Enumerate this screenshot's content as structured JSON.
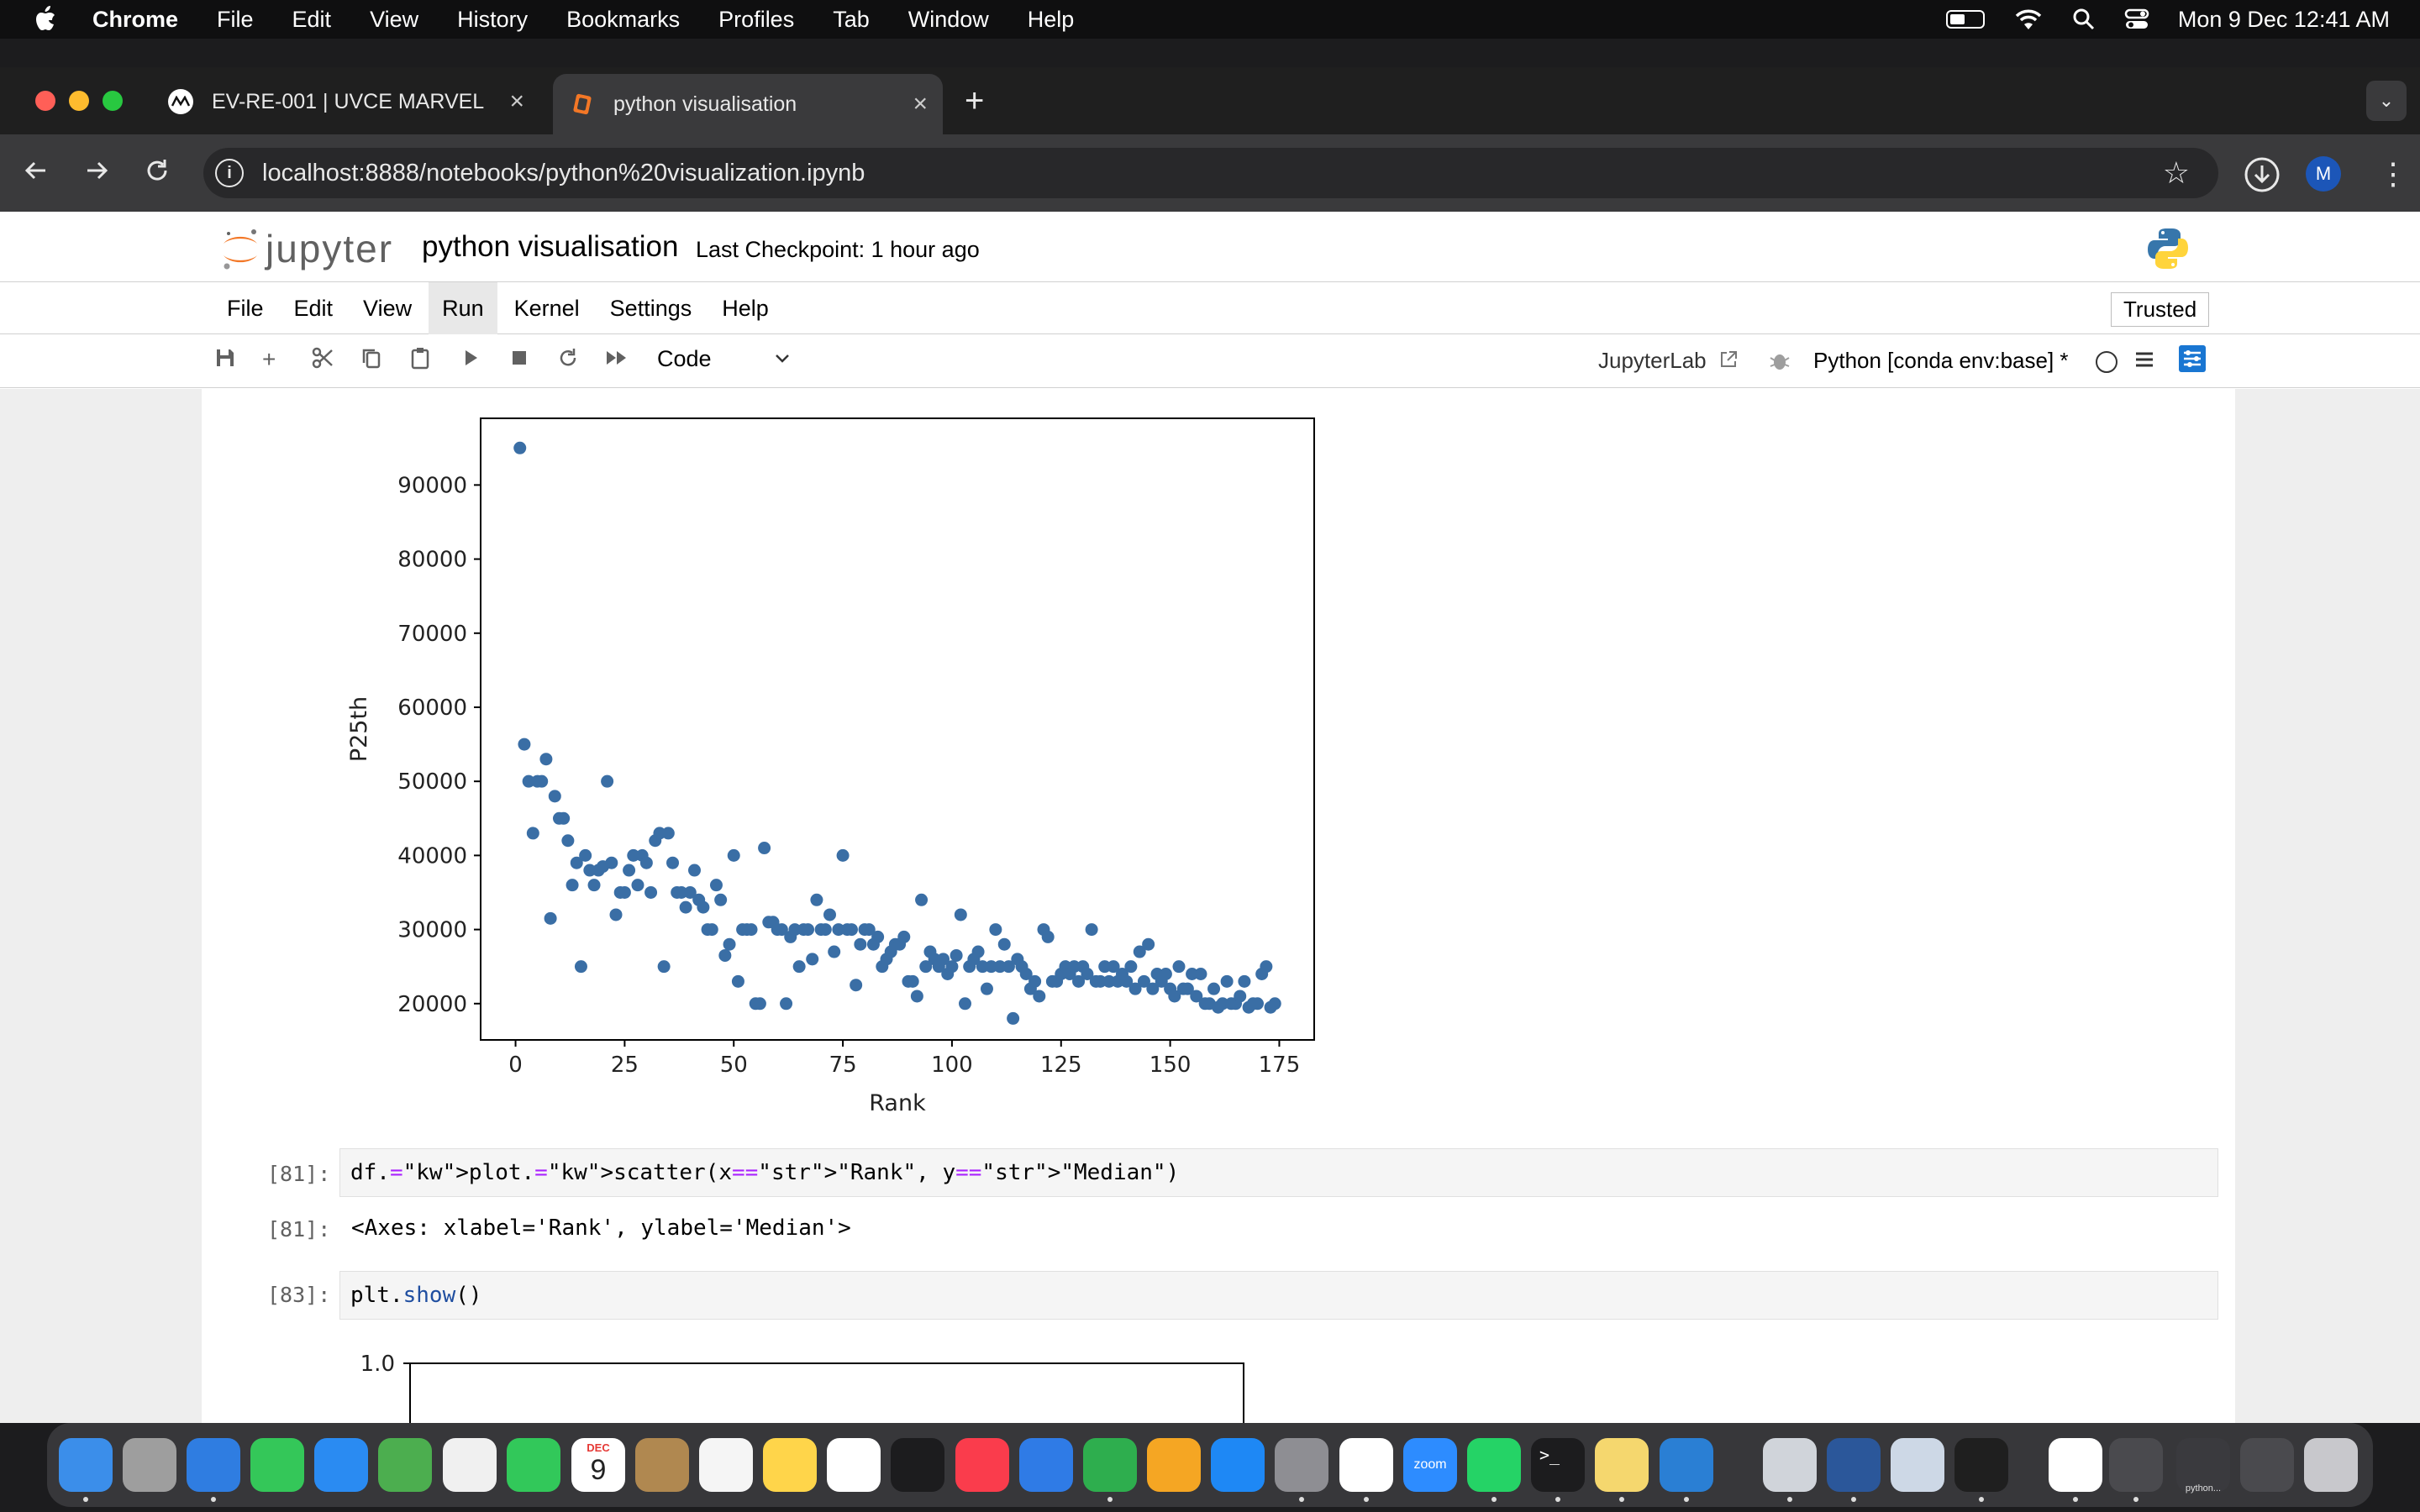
{
  "menubar": {
    "app_name": "Chrome",
    "items": [
      "File",
      "Edit",
      "View",
      "History",
      "Bookmarks",
      "Profiles",
      "Tab",
      "Window",
      "Help"
    ],
    "clock": "Mon 9 Dec  12:41 AM",
    "battery_level": 0.45
  },
  "browser": {
    "tabs": [
      {
        "title": "EV-RE-001 | UVCE MARVEL",
        "favicon": "marvel-logo-icon",
        "active": false
      },
      {
        "title": "python visualisation",
        "favicon": "jupyter-icon",
        "active": true
      }
    ],
    "url": "localhost:8888/notebooks/python%20visualization.ipynb",
    "profile_initial": "M"
  },
  "jupyter": {
    "logo_text": "jupyter",
    "notebook_title": "python visualisation",
    "checkpoint": "Last Checkpoint: 1 hour ago",
    "menu": [
      "File",
      "Edit",
      "View",
      "Run",
      "Kernel",
      "Settings",
      "Help"
    ],
    "active_menu": "Run",
    "trusted": "Trusted",
    "cell_type": "Code",
    "jupyterlab_link": "JupyterLab",
    "kernel": "Python [conda env:base] *"
  },
  "cells": {
    "c81_prompt_in": "[81]:",
    "c81_code": "df.plot.scatter(x=\"Rank\", y=\"Median\")",
    "c81_prompt_out": "[81]:",
    "c81_output": "<Axes: xlabel='Rank', ylabel='Median'>",
    "c83_prompt_in": "[83]:",
    "c83_code": "plt.show()"
  },
  "chart_data": [
    {
      "type": "scatter",
      "xlabel": "Rank",
      "ylabel": "P25th",
      "xlim": [
        -8,
        183
      ],
      "ylim": [
        15100,
        99000
      ],
      "xticks": [
        0,
        25,
        50,
        75,
        100,
        125,
        150,
        175
      ],
      "yticks": [
        20000,
        30000,
        40000,
        50000,
        60000,
        70000,
        80000,
        90000
      ],
      "grid": false,
      "marker_color": "#3a6ea5",
      "points": [
        [
          1,
          95000
        ],
        [
          2,
          55000
        ],
        [
          3,
          50000
        ],
        [
          4,
          43000
        ],
        [
          5,
          50000
        ],
        [
          6,
          50000
        ],
        [
          7,
          53000
        ],
        [
          8,
          31500
        ],
        [
          9,
          48000
        ],
        [
          10,
          45000
        ],
        [
          11,
          45000
        ],
        [
          12,
          42000
        ],
        [
          13,
          36000
        ],
        [
          14,
          39000
        ],
        [
          15,
          25000
        ],
        [
          16,
          40000
        ],
        [
          17,
          38000
        ],
        [
          18,
          36000
        ],
        [
          19,
          38000
        ],
        [
          20,
          38500
        ],
        [
          21,
          50000
        ],
        [
          22,
          39000
        ],
        [
          23,
          32000
        ],
        [
          24,
          35000
        ],
        [
          25,
          35000
        ],
        [
          26,
          38000
        ],
        [
          27,
          40000
        ],
        [
          28,
          36000
        ],
        [
          29,
          40000
        ],
        [
          30,
          39000
        ],
        [
          31,
          35000
        ],
        [
          32,
          42000
        ],
        [
          33,
          43000
        ],
        [
          34,
          25000
        ],
        [
          35,
          43000
        ],
        [
          36,
          39000
        ],
        [
          37,
          35000
        ],
        [
          38,
          35000
        ],
        [
          39,
          33000
        ],
        [
          40,
          35000
        ],
        [
          41,
          38000
        ],
        [
          42,
          34000
        ],
        [
          43,
          33000
        ],
        [
          44,
          30000
        ],
        [
          45,
          30000
        ],
        [
          46,
          36000
        ],
        [
          47,
          34000
        ],
        [
          48,
          26500
        ],
        [
          49,
          28000
        ],
        [
          50,
          40000
        ],
        [
          51,
          23000
        ],
        [
          52,
          30000
        ],
        [
          53,
          30000
        ],
        [
          54,
          30000
        ],
        [
          55,
          20000
        ],
        [
          56,
          20000
        ],
        [
          57,
          41000
        ],
        [
          58,
          31000
        ],
        [
          59,
          31000
        ],
        [
          60,
          30000
        ],
        [
          61,
          30000
        ],
        [
          62,
          20000
        ],
        [
          63,
          29000
        ],
        [
          64,
          30000
        ],
        [
          65,
          25000
        ],
        [
          66,
          30000
        ],
        [
          67,
          30000
        ],
        [
          68,
          26000
        ],
        [
          69,
          34000
        ],
        [
          70,
          30000
        ],
        [
          71,
          30000
        ],
        [
          72,
          32000
        ],
        [
          73,
          27000
        ],
        [
          74,
          30000
        ],
        [
          75,
          40000
        ],
        [
          76,
          30000
        ],
        [
          77,
          30000
        ],
        [
          78,
          22500
        ],
        [
          79,
          28000
        ],
        [
          80,
          30000
        ],
        [
          81,
          30000
        ],
        [
          82,
          28000
        ],
        [
          83,
          29000
        ],
        [
          84,
          25000
        ],
        [
          85,
          26000
        ],
        [
          86,
          27000
        ],
        [
          87,
          28000
        ],
        [
          88,
          28000
        ],
        [
          89,
          29000
        ],
        [
          90,
          23000
        ],
        [
          91,
          23000
        ],
        [
          92,
          21000
        ],
        [
          93,
          34000
        ],
        [
          94,
          25000
        ],
        [
          95,
          27000
        ],
        [
          96,
          26000
        ],
        [
          97,
          25000
        ],
        [
          98,
          26000
        ],
        [
          99,
          24000
        ],
        [
          100,
          25000
        ],
        [
          101,
          26500
        ],
        [
          102,
          32000
        ],
        [
          103,
          20000
        ],
        [
          104,
          25000
        ],
        [
          105,
          26000
        ],
        [
          106,
          27000
        ],
        [
          107,
          25000
        ],
        [
          108,
          22000
        ],
        [
          109,
          25000
        ],
        [
          110,
          30000
        ],
        [
          111,
          25000
        ],
        [
          112,
          28000
        ],
        [
          113,
          25000
        ],
        [
          114,
          18000
        ],
        [
          115,
          26000
        ],
        [
          116,
          25000
        ],
        [
          117,
          24000
        ],
        [
          118,
          22000
        ],
        [
          119,
          23000
        ],
        [
          120,
          21000
        ],
        [
          121,
          30000
        ],
        [
          122,
          29000
        ],
        [
          123,
          23000
        ],
        [
          124,
          23000
        ],
        [
          125,
          24000
        ],
        [
          126,
          25000
        ],
        [
          127,
          24000
        ],
        [
          128,
          25000
        ],
        [
          129,
          23000
        ],
        [
          130,
          25000
        ],
        [
          131,
          24000
        ],
        [
          132,
          30000
        ],
        [
          133,
          23000
        ],
        [
          134,
          23000
        ],
        [
          135,
          25000
        ],
        [
          136,
          23000
        ],
        [
          137,
          25000
        ],
        [
          138,
          23000
        ],
        [
          139,
          24000
        ],
        [
          140,
          23000
        ],
        [
          141,
          25000
        ],
        [
          142,
          22000
        ],
        [
          143,
          27000
        ],
        [
          144,
          23000
        ],
        [
          145,
          28000
        ],
        [
          146,
          22000
        ],
        [
          147,
          24000
        ],
        [
          148,
          23000
        ],
        [
          149,
          24000
        ],
        [
          150,
          22000
        ],
        [
          151,
          21000
        ],
        [
          152,
          25000
        ],
        [
          153,
          22000
        ],
        [
          154,
          22000
        ],
        [
          155,
          24000
        ],
        [
          156,
          21000
        ],
        [
          157,
          24000
        ],
        [
          158,
          20000
        ],
        [
          159,
          20000
        ],
        [
          160,
          22000
        ],
        [
          161,
          19500
        ],
        [
          162,
          20000
        ],
        [
          163,
          23000
        ],
        [
          164,
          20000
        ],
        [
          165,
          20000
        ],
        [
          166,
          21000
        ],
        [
          167,
          23000
        ],
        [
          168,
          19500
        ],
        [
          169,
          20000
        ],
        [
          170,
          20000
        ],
        [
          171,
          24000
        ],
        [
          172,
          25000
        ],
        [
          173,
          19500
        ],
        [
          174,
          20000
        ]
      ]
    },
    {
      "type": "scatter",
      "ytick_visible": "1.0",
      "note_partial": true,
      "points": []
    }
  ],
  "dock": {
    "apps": [
      "finder-icon",
      "launchpad-icon",
      "safari-icon",
      "messages-icon",
      "mail-icon",
      "maps-icon",
      "photos-icon",
      "facetime-icon",
      "calendar-icon",
      "contacts-icon",
      "reminders-icon",
      "notes-icon",
      "freeform-icon",
      "tv-icon",
      "music-icon",
      "keynote-icon",
      "numbers-icon",
      "pages-icon",
      "appstore-icon",
      "settings-icon",
      "chrome-icon",
      "zoom-icon",
      "whatsapp-icon",
      "terminal-icon",
      "python-launcher-icon",
      "vscode-icon",
      "xcode-icon",
      "word-icon",
      "preview-icon",
      "activity-icon",
      "document-icon",
      "window-thumb-1-icon",
      "window-thumb-2-icon",
      "window-thumb-3-icon",
      "trash-icon"
    ],
    "calendar_month": "DEC",
    "calendar_day": "9",
    "zoom_label": "zoom",
    "thumb_label": "python..."
  }
}
